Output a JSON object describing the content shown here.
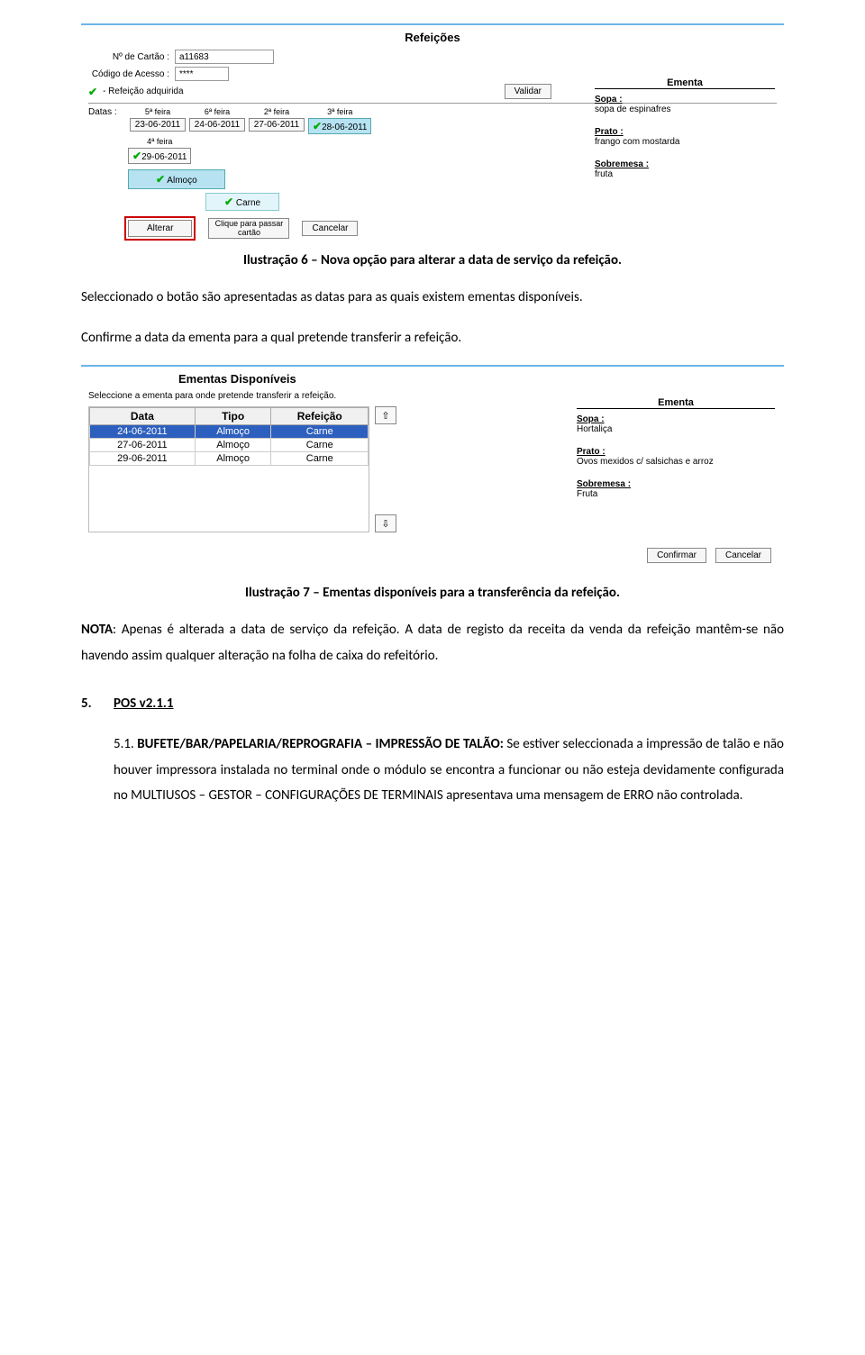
{
  "shot1": {
    "title": "Refeições",
    "lbl_cartao": "Nº de Cartão :",
    "val_cartao": "a11683",
    "lbl_codigo": "Código de Acesso :",
    "val_codigo": "****",
    "adquirida": "- Refeição adquirida",
    "validar_btn": "Validar",
    "datas_lbl": "Datas :",
    "days": [
      "5ª feira",
      "6ª feira",
      "2ª feira",
      "3ª feira",
      "4ª feira"
    ],
    "dates": [
      "23-06-2011",
      "24-06-2011",
      "27-06-2011",
      "28-06-2011",
      "29-06-2011"
    ],
    "almoco": "Almoço",
    "carne": "Carne",
    "alterar": "Alterar",
    "clique": "Clique para passar cartão",
    "cancelar": "Cancelar",
    "ementa": "Ementa",
    "sopa_lbl": "Sopa :",
    "sopa_val": "sopa de espinafres",
    "prato_lbl": "Prato :",
    "prato_val": "frango com mostarda",
    "sobre_lbl": "Sobremesa :",
    "sobre_val": "fruta"
  },
  "caption1": "Ilustração 6 – Nova opção para alterar a data de serviço da refeição.",
  "para1": "Seleccionado o botão são apresentadas as datas para as quais existem ementas disponíveis.",
  "para2": "Confirme a data da ementa para a qual pretende transferir a refeição.",
  "shot2": {
    "title": "Ementas Disponíveis",
    "instr": "Seleccione a ementa para onde pretende transferir a refeição.",
    "cols": [
      "Data",
      "Tipo",
      "Refeição"
    ],
    "rows": [
      [
        "24-06-2011",
        "Almoço",
        "Carne"
      ],
      [
        "27-06-2011",
        "Almoço",
        "Carne"
      ],
      [
        "29-06-2011",
        "Almoço",
        "Carne"
      ]
    ],
    "ementa": "Ementa",
    "sopa_lbl": "Sopa :",
    "sopa_val": "Hortaliça",
    "prato_lbl": "Prato :",
    "prato_val": "Ovos mexidos c/ salsichas e arroz",
    "sobre_lbl": "Sobremesa :",
    "sobre_val": "Fruta",
    "confirmar": "Confirmar",
    "cancelar": "Cancelar"
  },
  "caption2": "Ilustração 7 – Ementas disponíveis para a transferência da refeição.",
  "para3_strong": "NOTA",
  "para3": ": Apenas é alterada a data de serviço da refeição. A data de registo da receita da venda da refeição mantêm-se não havendo assim qualquer alteração na folha de caixa do refeitório.",
  "section_num": "5.",
  "section_title": "POS v2.1.1",
  "item_num": "5.1.",
  "item_strong": "BUFETE/BAR/PAPELARIA/REPROGRAFIA – IMPRESSÃO DE TALÃO:",
  "item_text": " Se estiver seleccionada a impressão de talão e não houver impressora instalada no terminal onde o módulo se encontra a funcionar ou não esteja devidamente configurada no MULTIUSOS – GESTOR – CONFIGURAÇÕES DE TERMINAIS apresentava uma mensagem de ERRO não controlada."
}
